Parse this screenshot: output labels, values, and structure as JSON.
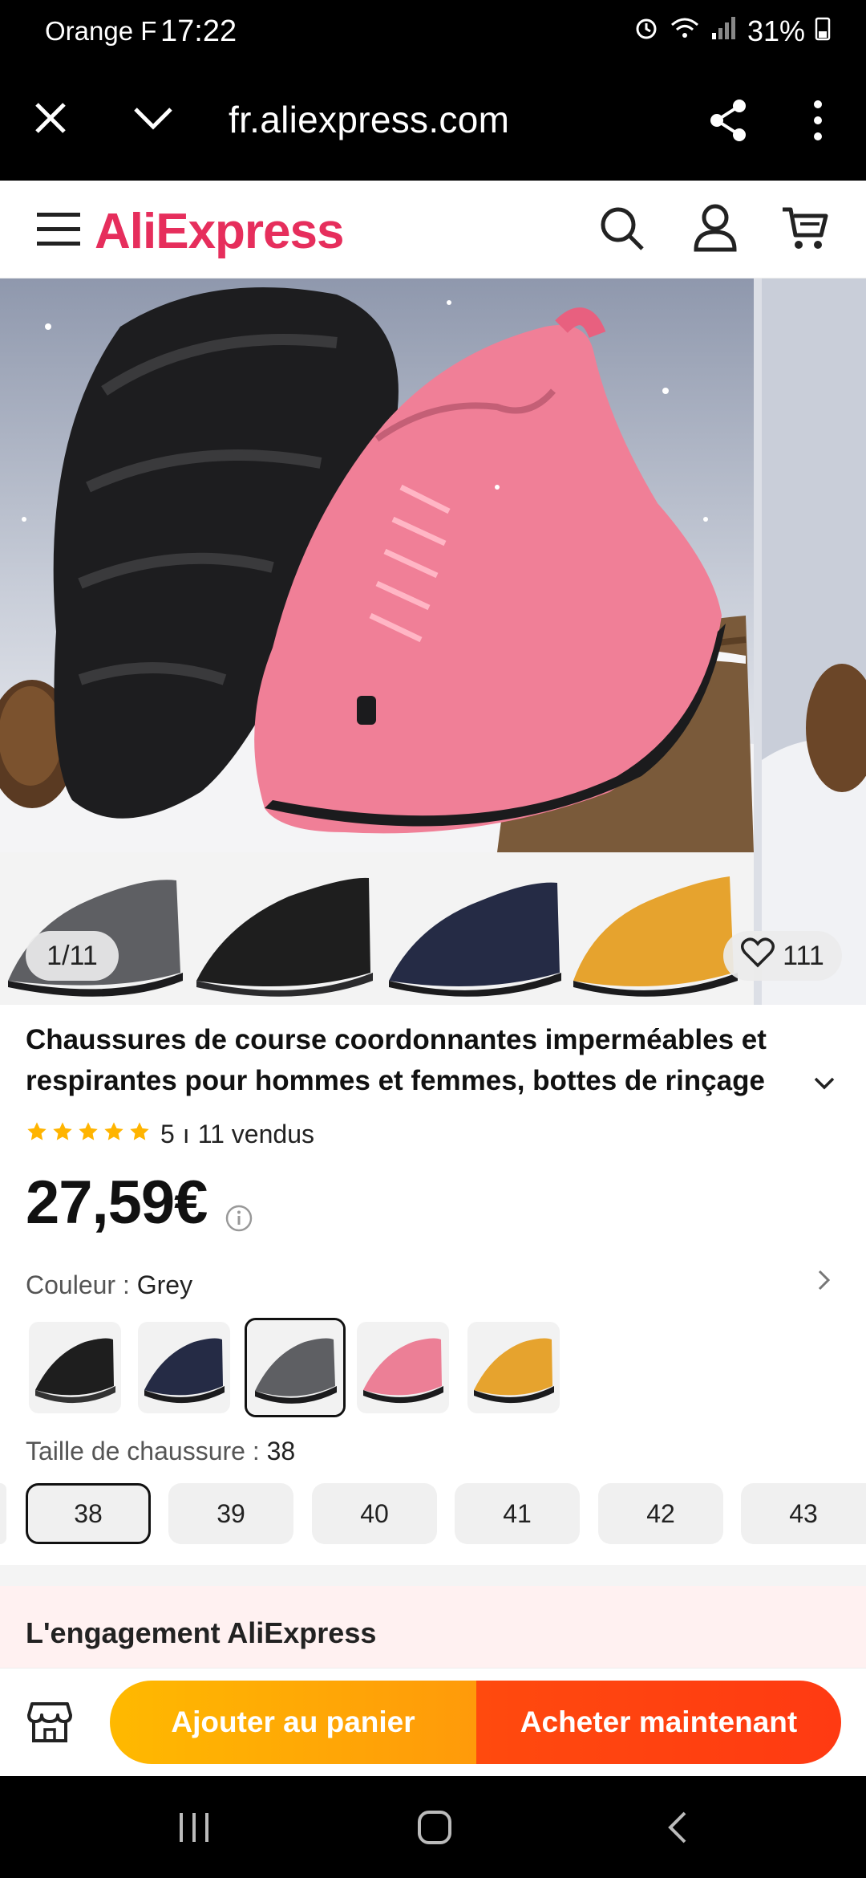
{
  "status_bar": {
    "carrier": "Orange F",
    "time": "17:22",
    "battery": "31%"
  },
  "browser": {
    "url": "fr.aliexpress.com"
  },
  "header": {
    "logo": "AliExpress"
  },
  "gallery": {
    "counter": "1/11",
    "wishlist_count": "111"
  },
  "product": {
    "title": "Chaussures de course coordonnantes imperméables et respirantes pour hommes et femmes, bottes de rinçage",
    "rating": "5",
    "separator": "ı",
    "sold": "11 vendus",
    "stars": 5,
    "price": "27,59€"
  },
  "color": {
    "label": "Couleur",
    "value": "Grey",
    "swatches": [
      {
        "name": "black",
        "color": "#1e1e1e"
      },
      {
        "name": "navy",
        "color": "#252b45"
      },
      {
        "name": "grey",
        "color": "#5e5f63"
      },
      {
        "name": "pink",
        "color": "#ec7f96"
      },
      {
        "name": "yellow",
        "color": "#e6a32e"
      }
    ]
  },
  "size": {
    "label": "Taille de chaussure",
    "value": "38",
    "options": [
      "38",
      "39",
      "40",
      "41",
      "42",
      "43"
    ]
  },
  "engagement": {
    "title": "L'engagement AliExpress"
  },
  "actions": {
    "add_to_cart": "Ajouter au panier",
    "buy_now": "Acheter maintenant"
  },
  "colors": {
    "brand_red": "#e62e5c",
    "cart_yellow": "#ffb400",
    "buy_orange": "#ff4a0e",
    "star": "#ffb400"
  }
}
